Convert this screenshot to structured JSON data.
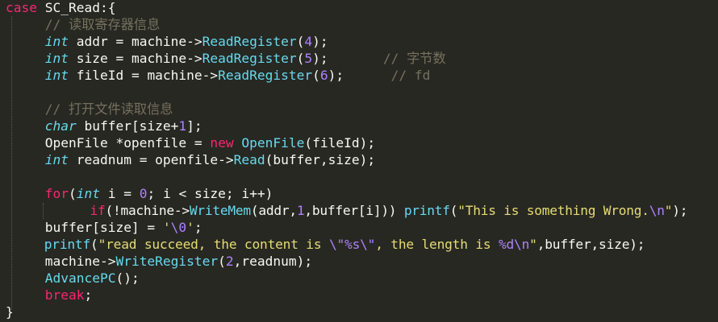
{
  "code": {
    "l1": {
      "kw": "case",
      "rest": " SC_Read:{"
    },
    "l2": {
      "comment": "// 读取寄存器信息"
    },
    "l3": {
      "type": "int",
      "a": " addr = machine->",
      "fn": "ReadRegister",
      "b": "(",
      "num": "4",
      "c": ");"
    },
    "l4": {
      "type": "int",
      "a": " size = machine->",
      "fn": "ReadRegister",
      "b": "(",
      "num": "5",
      "c": ");",
      "comment": "// 字节数"
    },
    "l5": {
      "type": "int",
      "a": " fileId = machine->",
      "fn": "ReadRegister",
      "b": "(",
      "num": "6",
      "c": ");",
      "comment": "// fd"
    },
    "l7": {
      "comment": "// 打开文件读取信息"
    },
    "l8": {
      "type": "char",
      "a": " buffer[size+",
      "num": "1",
      "c": "];"
    },
    "l9": {
      "a": "OpenFile *openfile = ",
      "kw": "new",
      "sp": " ",
      "fn": "OpenFile",
      "c": "(fileId);"
    },
    "l10": {
      "type": "int",
      "a": " readnum = openfile->",
      "fn": "Read",
      "c": "(buffer,size);"
    },
    "l12": {
      "kw": "for",
      "a": "(",
      "type": "int",
      "b": " i = ",
      "num": "0",
      "c": "; i < size; i++)"
    },
    "l13": {
      "kw": "if",
      "a": "(!machine->",
      "fn": "WriteMem",
      "b": "(addr,",
      "num": "1",
      "c": ",buffer[i])) ",
      "fn2": "printf",
      "d": "(",
      "str": "\"This is something Wrong.",
      "esc": "\\n",
      "str2": "\"",
      "e": ");"
    },
    "l14": {
      "a": "buffer[size] = ",
      "str": "'",
      "esc": "\\0",
      "str2": "'",
      "c": ";"
    },
    "l15": {
      "fn": "printf",
      "a": "(",
      "s1": "\"read succeed, the content is ",
      "e1": "\\\"",
      "e2": "%s",
      "e3": "\\\"",
      "s2": ", the length is ",
      "e4": "%d",
      "e5": "\\n",
      "s3": "\"",
      "b": ",buffer,size);"
    },
    "l16": {
      "a": "machine->",
      "fn": "WriteRegister",
      "b": "(",
      "num": "2",
      "c": ",readnum);"
    },
    "l17": {
      "fn": "AdvancePC",
      "c": "();"
    },
    "l18": {
      "kw": "break",
      "c": ";"
    },
    "l19": {
      "a": "}"
    }
  }
}
